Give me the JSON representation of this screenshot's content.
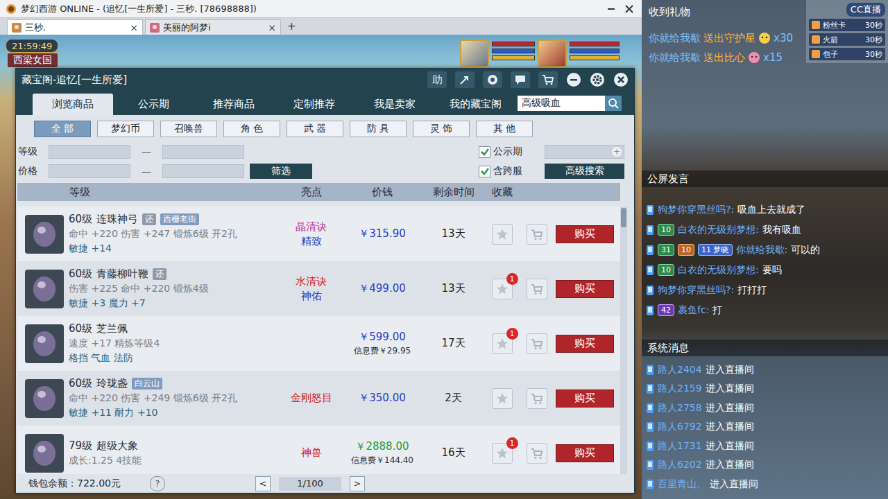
{
  "window": {
    "title": "梦幻西游 ONLINE - (追忆[一生所爱] - 三秒. [78698888])"
  },
  "browser_tabs": [
    {
      "label": "三秒.",
      "selected": true,
      "close": "×"
    },
    {
      "label": "美丽的阿梦i",
      "selected": false,
      "close": "×"
    }
  ],
  "new_tab": "+",
  "hud": {
    "time": "21:59:49",
    "location": "西梁女国"
  },
  "dialog": {
    "title": "藏宝阁-追忆[一生所爱]",
    "help": "助",
    "tabs": [
      {
        "label": "浏览商品",
        "selected": true
      },
      {
        "label": "公示期",
        "selected": false
      },
      {
        "label": "推荐商品",
        "selected": false
      },
      {
        "label": "定制推荐",
        "selected": false
      },
      {
        "label": "我是卖家",
        "selected": false
      },
      {
        "label": "我的藏宝阁",
        "selected": false
      }
    ],
    "search": {
      "value": "高级吸血"
    },
    "categories": [
      {
        "label": "全 部",
        "selected": true
      },
      {
        "label": "梦幻币",
        "selected": false
      },
      {
        "label": "召唤兽",
        "selected": false
      },
      {
        "label": "角 色",
        "selected": false
      },
      {
        "label": "武 器",
        "selected": false
      },
      {
        "label": "防 具",
        "selected": false
      },
      {
        "label": "灵 饰",
        "selected": false
      },
      {
        "label": "其 他",
        "selected": false
      }
    ],
    "filters": {
      "level_label": "等级",
      "price_label": "价格",
      "dash": "—",
      "filter_button": "筛选",
      "field_icon": "+",
      "options": [
        {
          "label": "公示期",
          "checked": true
        },
        {
          "label": "含跨服",
          "checked": true
        }
      ],
      "advanced_button": "高级搜索"
    },
    "table": {
      "columns": [
        "等级",
        "亮点",
        "价钱",
        "剩余时间",
        "收藏"
      ],
      "rows": [
        {
          "level": "60级",
          "name": "连珠神弓",
          "tags": [
            {
              "label": "还",
              "kind": "return"
            },
            {
              "label": "西栅老街",
              "kind": "server"
            }
          ],
          "stats": [
            "命中 +220 伤害 +247 锻炼6级 开2孔",
            "敏捷 +14"
          ],
          "highlights": [
            {
              "label": "晶清诀",
              "color": "#c0309a"
            },
            {
              "label": "精致",
              "color": "#2a3cc8"
            }
          ],
          "price": "￥315.90",
          "price_color": "#2a3cc8",
          "time": "13天",
          "buy": "购买"
        },
        {
          "level": "60级",
          "name": "青藤柳叶鞭",
          "tags": [
            {
              "label": "还",
              "kind": "return"
            }
          ],
          "stats": [
            "伤害 +225 命中 +220 锻炼4级",
            "敏捷 +3 魔力 +7"
          ],
          "highlights": [
            {
              "label": "水清诀",
              "color": "#d02020"
            },
            {
              "label": "神佑",
              "color": "#2a3cc8"
            }
          ],
          "price": "￥499.00",
          "price_color": "#2a3cc8",
          "time": "13天",
          "fav_count": "1",
          "buy": "购买"
        },
        {
          "level": "60级",
          "name": "芝兰佩",
          "tags": [],
          "stats": [
            "速度 +17 精炼等级4",
            "格挡 气血 法防"
          ],
          "highlights": [],
          "price": "￥599.00",
          "price_color": "#2a3cc8",
          "fee": "信息费￥29.95",
          "time": "17天",
          "fav_count": "1",
          "buy": "购买"
        },
        {
          "level": "60级",
          "name": "玲珑盏",
          "tags": [
            {
              "label": "白云山",
              "kind": "server"
            }
          ],
          "stats": [
            "命中 +220 伤害 +249 锻炼6级 开2孔",
            "敏捷 +11 耐力 +10"
          ],
          "highlights": [
            {
              "label": "金刚怒目",
              "color": "#d02020"
            }
          ],
          "price": "￥350.00",
          "price_color": "#2a3cc8",
          "time": "2天",
          "buy": "购买"
        },
        {
          "level": "79级",
          "name": "超级大象",
          "tags": [],
          "stats": [
            "成长:1.25 4技能"
          ],
          "highlights": [
            {
              "label": "神兽",
              "color": "#d02020"
            }
          ],
          "price": "￥2888.00",
          "price_color": "#2a9a3a",
          "fee": "信息费￥144.40",
          "time": "16天",
          "fav_count": "1",
          "buy": "购买"
        }
      ]
    },
    "footer": {
      "balance": "钱包余额：722.00元",
      "help": "?",
      "prev": "<",
      "page": "1/100",
      "next": ">"
    }
  },
  "stream": {
    "gifts": {
      "title": "收到礼物",
      "messages": [
        {
          "user": "你就给我歇",
          "action": "送出守护星",
          "count": "x30"
        },
        {
          "user": "你就给我歇",
          "action": "送出比心",
          "count": "x15"
        }
      ]
    },
    "gift_panel": {
      "logo": "CC直播",
      "items": [
        {
          "name": "粉丝卡",
          "time": "30秒"
        },
        {
          "name": "火箭",
          "time": "30秒"
        },
        {
          "name": "包子",
          "time": "30秒"
        }
      ]
    },
    "chat": {
      "title": "公屏发言",
      "messages": [
        {
          "badges": [],
          "user": "狗梦你穿黑丝吗?:",
          "text": "吸血上去就成了"
        },
        {
          "badges": [
            {
              "label": "10",
              "kind": "level"
            }
          ],
          "user": "白衣的无级别梦想:",
          "text": "我有吸血"
        },
        {
          "badges": [
            {
              "label": "31",
              "kind": "level"
            },
            {
              "label": "10",
              "kind": "fan"
            },
            {
              "label": "11 梦晓",
              "kind": "club"
            }
          ],
          "user": "你就给我歇:",
          "text": "可以的"
        },
        {
          "badges": [
            {
              "label": "10",
              "kind": "level"
            }
          ],
          "user": "白衣的无级别梦想:",
          "text": "要吗"
        },
        {
          "badges": [],
          "user": "狗梦你穿黑丝吗?:",
          "text": "打打打"
        },
        {
          "badges": [
            {
              "label": "42",
              "kind": "vip"
            }
          ],
          "user": "裹鱼fc:",
          "text": "打"
        }
      ]
    },
    "system": {
      "title": "系统消息",
      "messages": [
        {
          "user": "路人2404",
          "text": "进入直播间"
        },
        {
          "user": "路人2159",
          "text": "进入直播间"
        },
        {
          "user": "路人2758",
          "text": "进入直播间"
        },
        {
          "user": "路人6792",
          "text": "进入直播间"
        },
        {
          "user": "路人1731",
          "text": "进入直播间"
        },
        {
          "user": "路人6202",
          "text": "进入直播间"
        },
        {
          "user": "百里青山。",
          "text": "进入直播间"
        }
      ]
    }
  }
}
